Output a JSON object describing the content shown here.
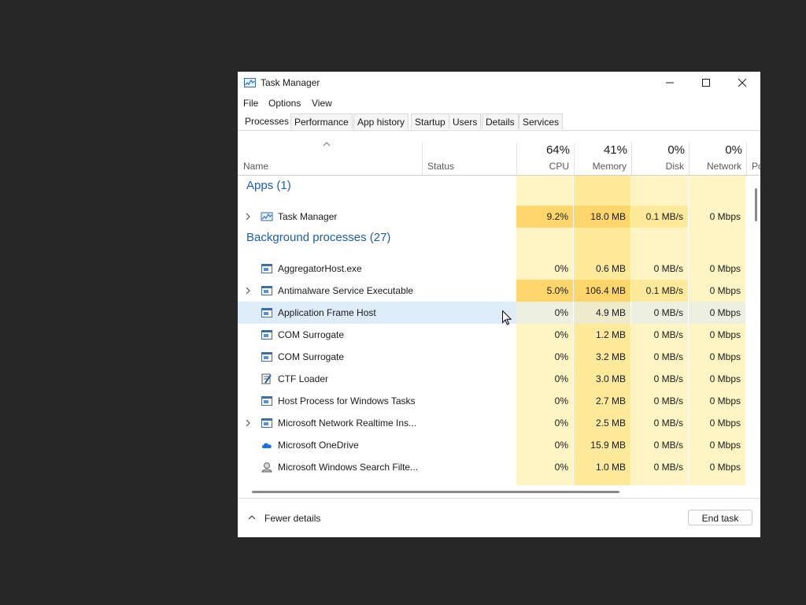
{
  "window": {
    "title": "Task Manager",
    "controls": {
      "minimize": "minimize",
      "maximize": "maximize",
      "close": "close"
    }
  },
  "menu": [
    "File",
    "Options",
    "View"
  ],
  "tabs": [
    "Processes",
    "Performance",
    "App history",
    "Startup",
    "Users",
    "Details",
    "Services"
  ],
  "active_tab": "Processes",
  "columns": {
    "name": "Name",
    "status": "Status",
    "cpu": {
      "pct": "64%",
      "label": "CPU"
    },
    "memory": {
      "pct": "41%",
      "label": "Memory"
    },
    "disk": {
      "pct": "0%",
      "label": "Disk"
    },
    "network": {
      "pct": "0%",
      "label": "Network"
    },
    "power_partial": "Po"
  },
  "groups": {
    "apps": "Apps (1)",
    "background": "Background processes (27)"
  },
  "apps": [
    {
      "name": "Task Manager",
      "cpu": "9.2%",
      "memory": "18.0 MB",
      "disk": "0.1 MB/s",
      "network": "0 Mbps",
      "icon": "task-manager-icon",
      "expandable": true
    }
  ],
  "processes": [
    {
      "name": "AggregatorHost.exe",
      "cpu": "0%",
      "memory": "0.6 MB",
      "disk": "0 MB/s",
      "network": "0 Mbps",
      "icon": "window-icon",
      "expandable": false
    },
    {
      "name": "Antimalware Service Executable",
      "cpu": "5.0%",
      "memory": "106.4 MB",
      "disk": "0.1 MB/s",
      "network": "0 Mbps",
      "icon": "window-icon",
      "expandable": true
    },
    {
      "name": "Application Frame Host",
      "cpu": "0%",
      "memory": "4.9 MB",
      "disk": "0 MB/s",
      "network": "0 Mbps",
      "icon": "window-icon",
      "expandable": false
    },
    {
      "name": "COM Surrogate",
      "cpu": "0%",
      "memory": "1.2 MB",
      "disk": "0 MB/s",
      "network": "0 Mbps",
      "icon": "window-icon",
      "expandable": false
    },
    {
      "name": "COM Surrogate",
      "cpu": "0%",
      "memory": "3.2 MB",
      "disk": "0 MB/s",
      "network": "0 Mbps",
      "icon": "window-icon",
      "expandable": false
    },
    {
      "name": "CTF Loader",
      "cpu": "0%",
      "memory": "3.0 MB",
      "disk": "0 MB/s",
      "network": "0 Mbps",
      "icon": "ctf-loader-icon",
      "expandable": false
    },
    {
      "name": "Host Process for Windows Tasks",
      "cpu": "0%",
      "memory": "2.7 MB",
      "disk": "0 MB/s",
      "network": "0 Mbps",
      "icon": "window-icon",
      "expandable": false
    },
    {
      "name": "Microsoft Network Realtime Ins...",
      "cpu": "0%",
      "memory": "2.5 MB",
      "disk": "0 MB/s",
      "network": "0 Mbps",
      "icon": "window-icon",
      "expandable": true
    },
    {
      "name": "Microsoft OneDrive",
      "cpu": "0%",
      "memory": "15.9 MB",
      "disk": "0 MB/s",
      "network": "0 Mbps",
      "icon": "cloud-icon",
      "expandable": false
    },
    {
      "name": "Microsoft Windows Search Filte...",
      "cpu": "0%",
      "memory": "1.0 MB",
      "disk": "0 MB/s",
      "network": "0 Mbps",
      "icon": "search-filter-icon",
      "expandable": false
    }
  ],
  "footer": {
    "fewer_details": "Fewer details",
    "end_task": "End task"
  },
  "colors": {
    "heat_light": "#fff4c4",
    "heat_mid": "#ffe99a",
    "heat_high": "#ffd66b",
    "group_title": "#1f5fa8",
    "hover_row": "#deecf9"
  }
}
